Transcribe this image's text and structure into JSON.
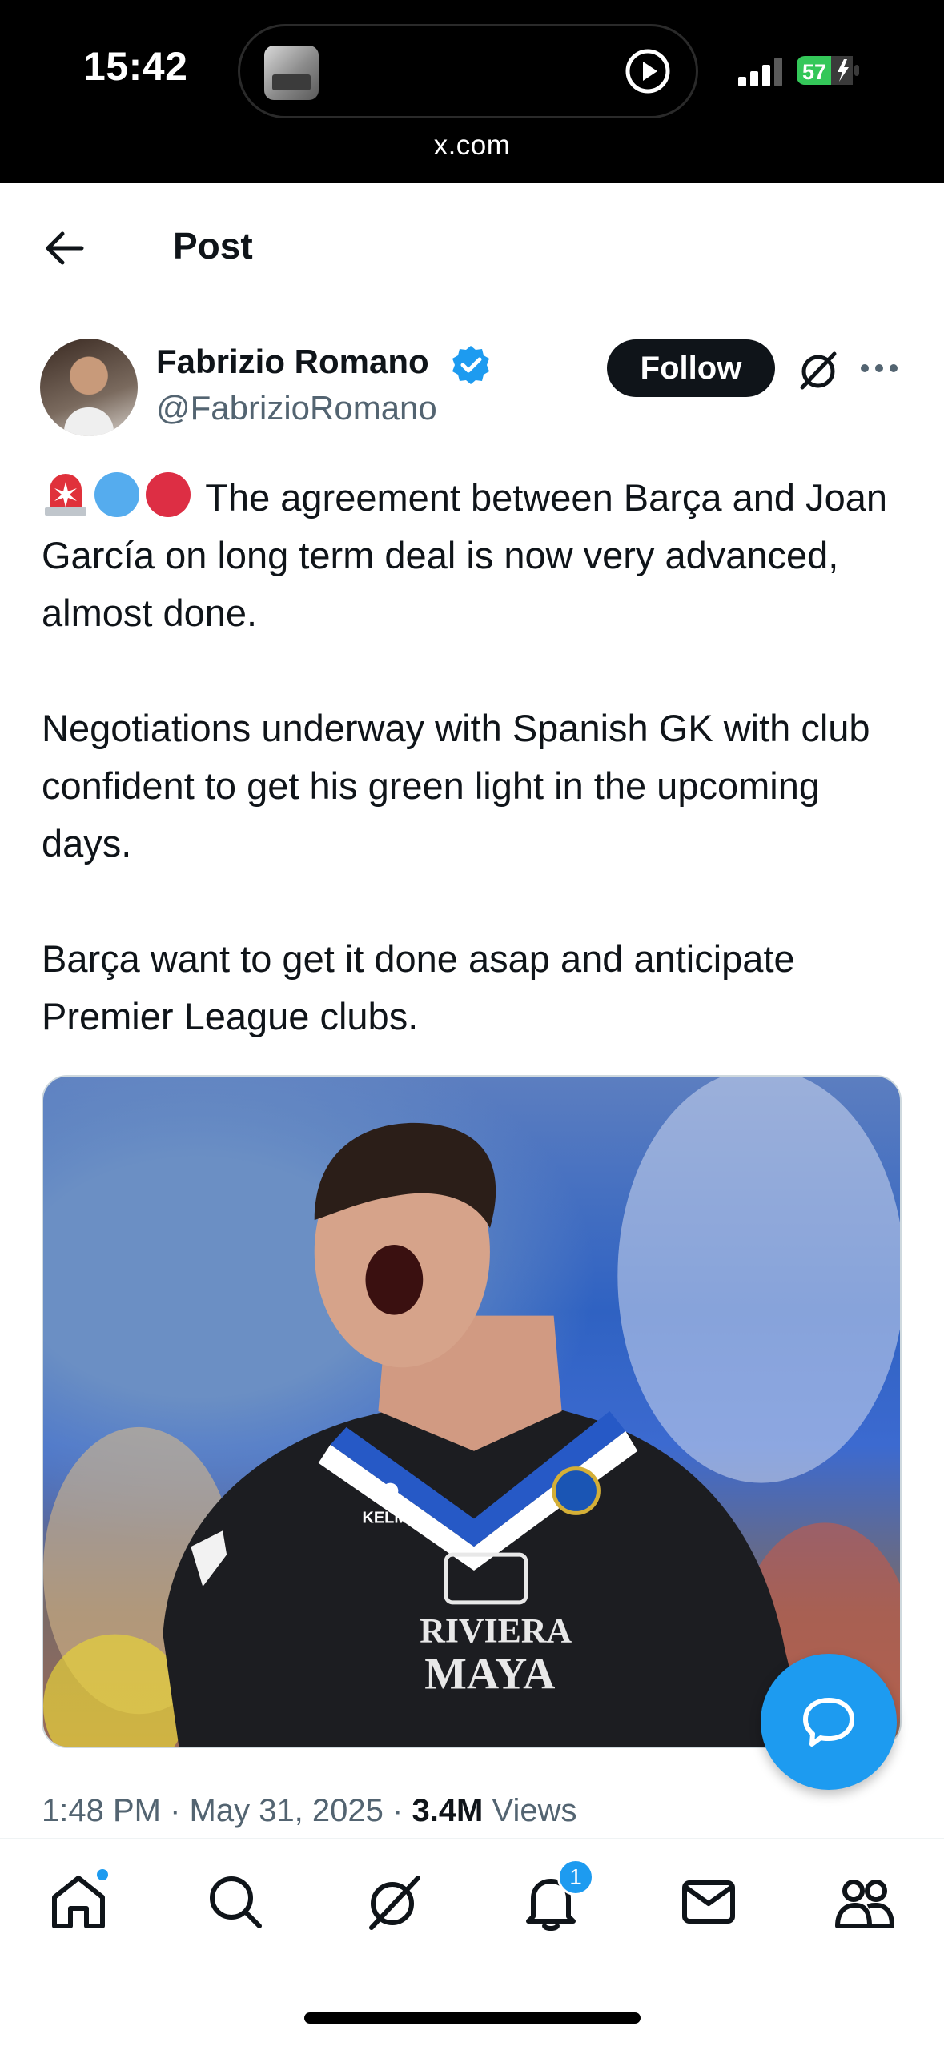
{
  "status_bar": {
    "time": "15:42",
    "battery": "57",
    "url": "x.com"
  },
  "header": {
    "back_icon": "arrow-left-icon",
    "title": "Post"
  },
  "author": {
    "name": "Fabrizio Romano",
    "handle": "@FabrizioRomano",
    "verified": true,
    "follow_label": "Follow"
  },
  "tweet": {
    "emojis": [
      "rotating-light-icon",
      "blue-circle-icon",
      "red-circle-icon"
    ],
    "paragraph1": "The agreement between Barça and Joan García on long term deal is now very advanced, almost done.",
    "paragraph2": "Negotiations underway with Spanish GK with club confident to get his green light in the upcoming days.",
    "paragraph3": "Barça want to get it done asap and anticipate Premier League clubs.",
    "media": {
      "shirt_brand": "KELME",
      "sponsor_line1": "RIVIERA",
      "sponsor_line2": "MAYA"
    },
    "timestamp": "1:48 PM · May 31, 2025 ·",
    "views_count": "3.4M",
    "views_label": "Views"
  },
  "nav": {
    "items": [
      "home-icon",
      "search-icon",
      "grok-icon",
      "notifications-icon",
      "messages-icon",
      "communities-icon"
    ],
    "notification_badge": "1"
  },
  "colors": {
    "accent": "#1d9bf0",
    "text": "#0f1419",
    "secondary": "#536471"
  }
}
